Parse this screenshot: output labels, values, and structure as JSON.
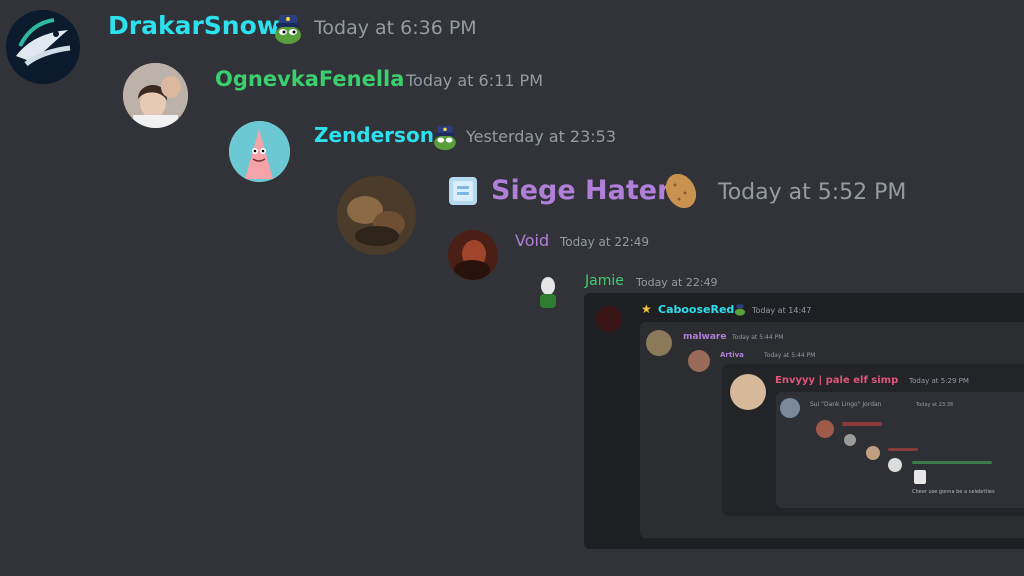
{
  "colors": {
    "background": "#313338",
    "timestamp": "#949ba4",
    "cyan_name": "#2de0ee",
    "green_name": "#3ccf6f",
    "purple_name": "#b07fd9",
    "pink_name": "#e0557a"
  },
  "messages": [
    {
      "username": "DrakarSnow",
      "timestamp": "Today at 6:36 PM",
      "badge_icon": "pepe-police-icon"
    },
    {
      "username": "OgnevkaFenella",
      "timestamp": "Today at 6:11 PM"
    },
    {
      "username": "Zenderson",
      "timestamp": "Yesterday at 23:53",
      "badge_icon": "pepe-police-icon"
    },
    {
      "username": "Siege Hater",
      "timestamp": "Today at 5:52 PM",
      "badge_icon": "ice-cube-icon",
      "badge_icon_2": "potato-icon"
    },
    {
      "username": "Void",
      "timestamp": "Today at 22:49"
    },
    {
      "username": "Jamie",
      "timestamp": "Today at 22:49"
    }
  ],
  "embed": {
    "username": "CabooseRed",
    "timestamp": "Today at 14:47",
    "nested_1": {
      "username": "malware",
      "timestamp": "Today at 5:44 PM"
    },
    "nested_2": {
      "username": "Artiva",
      "timestamp": "Today at 5:44 PM"
    },
    "nested_3": {
      "username": "Envyyy | pale elf simp",
      "timestamp": "Today at 5:29 PM"
    },
    "nested_4": {
      "username": "Sui \"Dank Lingo\" Jordan",
      "timestamp": "Today at 23:38"
    },
    "footer_text": "Cheer use gonna be a celebrities"
  }
}
